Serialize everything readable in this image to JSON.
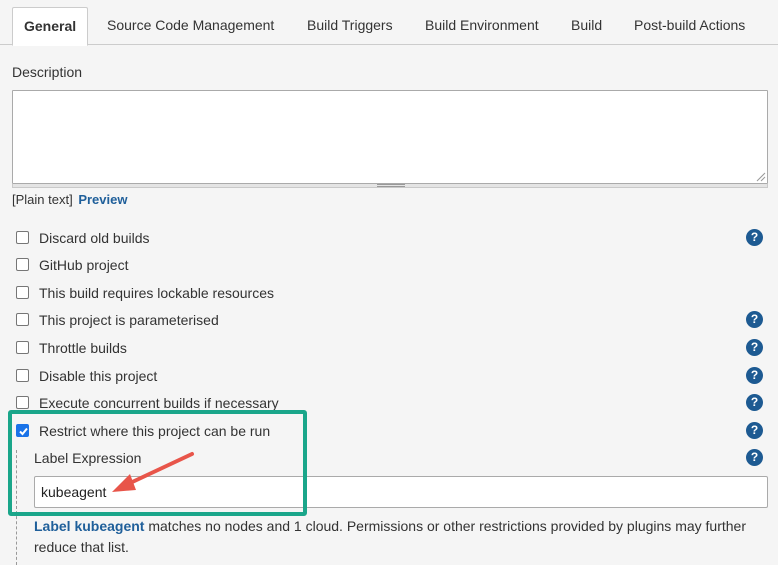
{
  "tabs": [
    {
      "label": "General"
    },
    {
      "label": "Source Code Management"
    },
    {
      "label": "Build Triggers"
    },
    {
      "label": "Build Environment"
    },
    {
      "label": "Build"
    },
    {
      "label": "Post-build Actions"
    }
  ],
  "description": {
    "label": "Description",
    "value": "",
    "format_text": "[Plain text]",
    "preview_link": "Preview"
  },
  "options": [
    {
      "label": "Discard old builds",
      "checked": false,
      "help": true
    },
    {
      "label": "GitHub project",
      "checked": false,
      "help": false
    },
    {
      "label": "This build requires lockable resources",
      "checked": false,
      "help": false
    },
    {
      "label": "This project is parameterised",
      "checked": false,
      "help": true
    },
    {
      "label": "Throttle builds",
      "checked": false,
      "help": true
    },
    {
      "label": "Disable this project",
      "checked": false,
      "help": true
    },
    {
      "label": "Execute concurrent builds if necessary",
      "checked": false,
      "help": true
    },
    {
      "label": "Restrict where this project can be run",
      "checked": true,
      "help": true
    }
  ],
  "label_expression": {
    "label": "Label Expression",
    "value": "kubeagent",
    "info_link": "Label kubeagent",
    "info_text": " matches no nodes and 1 cloud. Permissions or other restrictions provided by plugins may further reduce that list."
  },
  "help_glyph": "?",
  "colors": {
    "highlight_box": "#1aa68a",
    "arrow": "#e8554a",
    "link": "#1f5f9a",
    "help_icon": "#1d5a92"
  }
}
